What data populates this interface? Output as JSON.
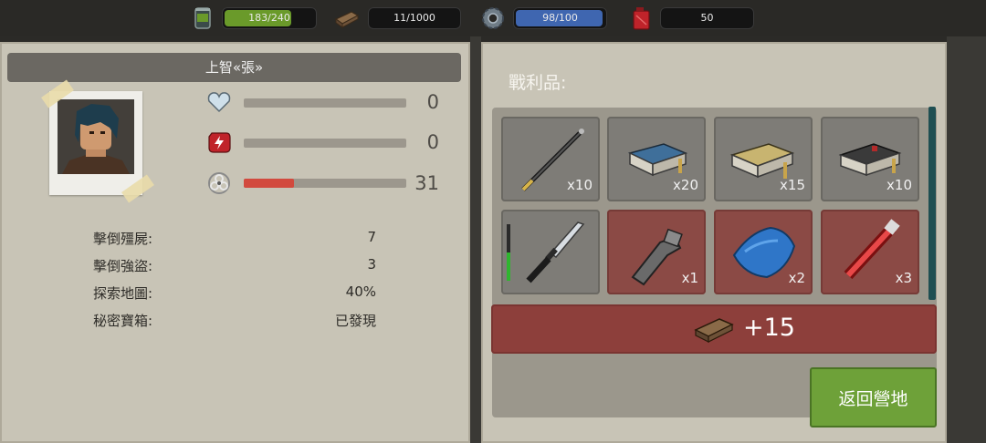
{
  "resources": [
    {
      "name": "food",
      "icon": "food-can-icon",
      "text": "183/240",
      "fill": 0.7625,
      "color": "#6a9a2a"
    },
    {
      "name": "wood",
      "icon": "wood-plank-icon",
      "text": "11/1000",
      "fill": 0.011,
      "color": "#7a5a3a"
    },
    {
      "name": "parts",
      "icon": "gear-icon",
      "text": "98/100",
      "fill": 0.98,
      "color": "#3f66b0"
    },
    {
      "name": "fuel",
      "icon": "fuel-canister-icon",
      "text": "50",
      "fill": 0,
      "color": "#c0232a"
    }
  ],
  "survivor": {
    "name": "上智«張»",
    "stats": [
      {
        "icon": "heart-icon",
        "value": "0",
        "fill": 0
      },
      {
        "icon": "energy-icon",
        "value": "0",
        "fill": 0
      },
      {
        "icon": "biohazard-icon",
        "value": "31",
        "fill": 0.31,
        "color": "#d24a3e"
      }
    ],
    "info": [
      {
        "label": "擊倒殭屍:",
        "value": "7"
      },
      {
        "label": "擊倒強盜:",
        "value": "3"
      },
      {
        "label": "探索地圖:",
        "value": "40%"
      },
      {
        "label": "秘密寶箱:",
        "value": "已發現"
      }
    ]
  },
  "loot": {
    "title": "戰利品:",
    "items": [
      {
        "name": "spear",
        "qty": "x10"
      },
      {
        "name": "blue-ammo-box",
        "qty": "x20"
      },
      {
        "name": "yellow-ammo-box",
        "qty": "x15"
      },
      {
        "name": "black-ammo-box",
        "qty": "x10"
      },
      {
        "name": "knife",
        "qty": ""
      },
      {
        "name": "pipe-fitting",
        "qty": "x1"
      },
      {
        "name": "blue-tarp",
        "qty": "x2"
      },
      {
        "name": "flashlight",
        "qty": "x3"
      }
    ],
    "wood_bonus": "+15",
    "knife_condition": 0.5
  },
  "return_button": "返回營地"
}
